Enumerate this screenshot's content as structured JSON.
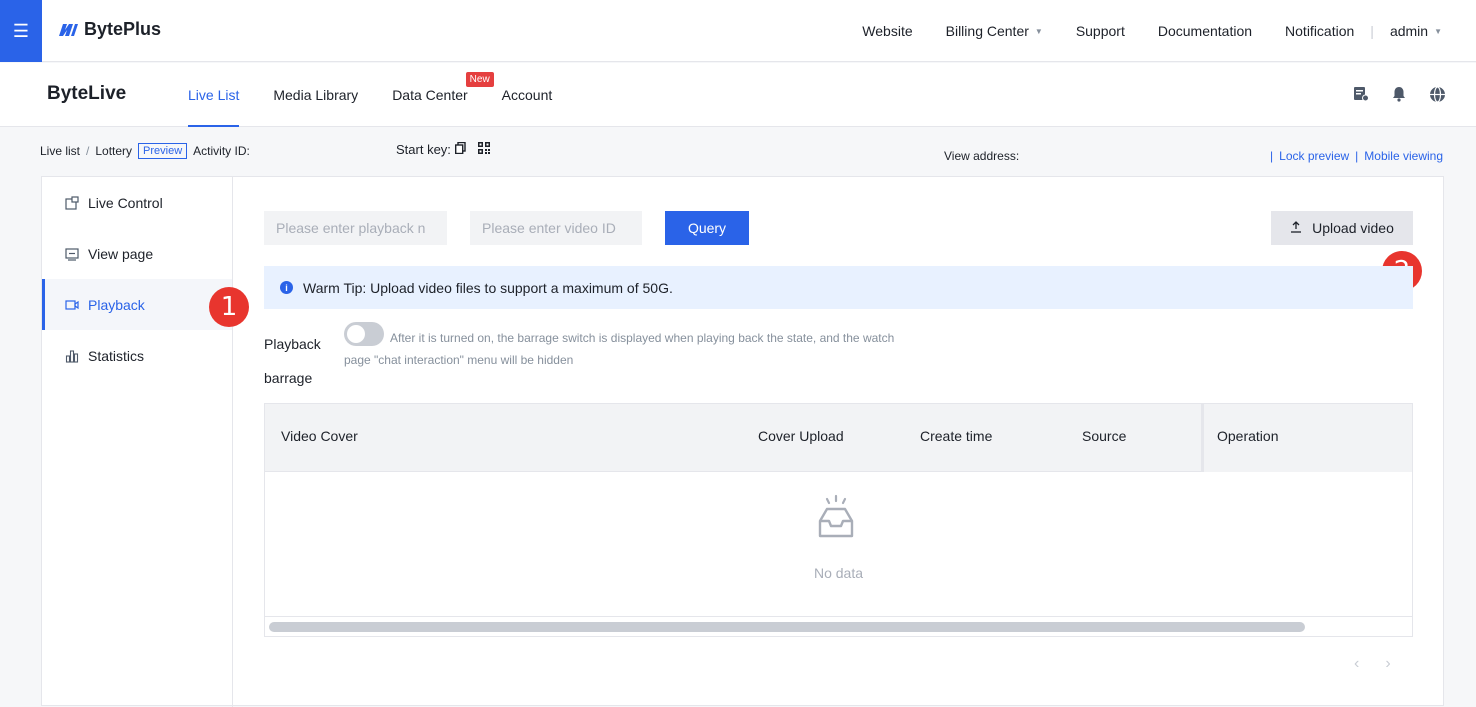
{
  "topbar": {
    "menu_icon": "hamburger-icon",
    "logo_text": "BytePlus",
    "nav": {
      "website": "Website",
      "billing": "Billing Center",
      "support": "Support",
      "documentation": "Documentation",
      "notification": "Notification",
      "separator": "|",
      "user": "admin"
    }
  },
  "product": {
    "title": "ByteLive",
    "tabs": {
      "live_list": "Live List",
      "media_library": "Media Library",
      "data_center": "Data Center",
      "data_center_badge": "New",
      "account": "Account"
    },
    "active_tab": "Live List"
  },
  "breadcrumb": {
    "live_list": "Live list",
    "sep": "/",
    "lottery": "Lottery",
    "preview_tag": "Preview",
    "activity_id": "Activity ID:",
    "start_key": "Start key:",
    "view_address": "View address:",
    "bar1": "|",
    "lock_preview": "Lock preview",
    "bar2": "|",
    "mobile_viewing": "Mobile viewing"
  },
  "sidebar": {
    "items": [
      {
        "label": "Live Control",
        "icon": "live-control-icon"
      },
      {
        "label": "View page",
        "icon": "view-page-icon"
      },
      {
        "label": "Playback",
        "icon": "playback-icon"
      },
      {
        "label": "Statistics",
        "icon": "statistics-icon"
      }
    ],
    "active": "Playback"
  },
  "markers": {
    "one": "1",
    "two": "2"
  },
  "playback": {
    "search_placeholder": "Please enter playback n",
    "video_id_placeholder": "Please enter video ID",
    "query_label": "Query",
    "upload_label": "Upload video",
    "tip": "Warm Tip: Upload video files to support a maximum of 50G.",
    "barrage_label": "Playback barrage",
    "barrage_enabled": false,
    "barrage_desc": "After it is turned on, the barrage switch is displayed when playing back the state, and the watch page \"chat interaction\" menu will be hidden"
  },
  "table": {
    "columns": {
      "video_cover": "Video Cover",
      "cover_upload": "Cover Upload",
      "create_time": "Create time",
      "source": "Source",
      "operation": "Operation"
    },
    "rows": [],
    "empty_text": "No data"
  },
  "colors": {
    "accent": "#2a63e8",
    "marker": "#e8352e",
    "badge": "#e53f3f"
  }
}
